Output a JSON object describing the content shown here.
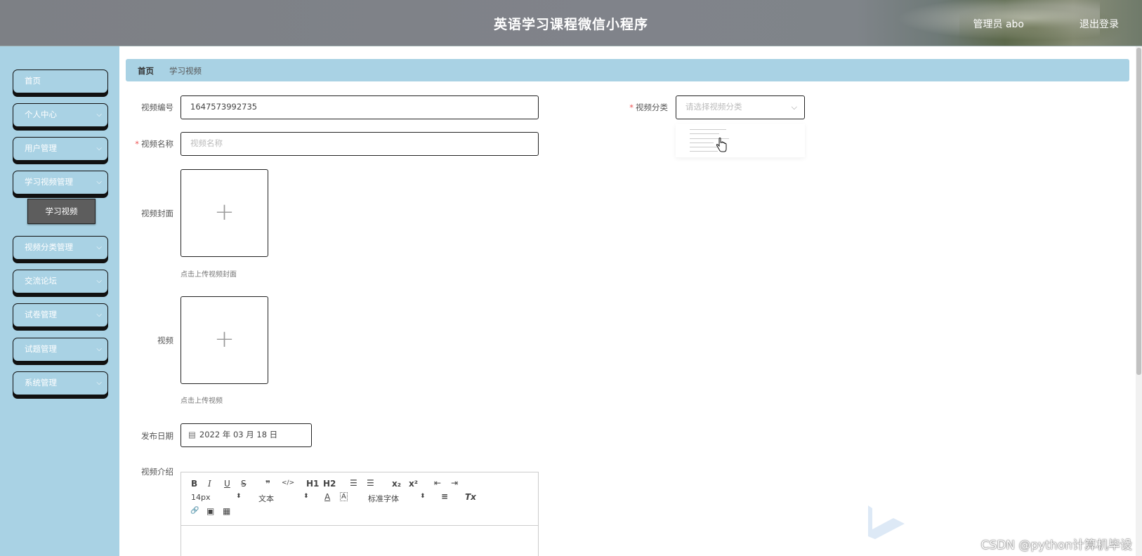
{
  "header": {
    "title": "英语学习课程微信小程序",
    "user": "管理员 abo",
    "logout": "退出登录"
  },
  "sidebar": {
    "items": [
      {
        "label": "首页",
        "has_children": false
      },
      {
        "label": "个人中心",
        "has_children": true
      },
      {
        "label": "用户管理",
        "has_children": true
      },
      {
        "label": "学习视频管理",
        "has_children": true
      },
      {
        "label": "视频分类管理",
        "has_children": true
      },
      {
        "label": "交流论坛",
        "has_children": true
      },
      {
        "label": "试卷管理",
        "has_children": true
      },
      {
        "label": "试题管理",
        "has_children": true
      },
      {
        "label": "系统管理",
        "has_children": true
      }
    ],
    "subitem": "学习视频"
  },
  "breadcrumb": {
    "home": "首页",
    "current": "学习视频"
  },
  "form": {
    "video_no": {
      "label": "视频编号",
      "value": "1647573992735"
    },
    "video_name": {
      "label": "视频名称",
      "placeholder": "视频名称",
      "required": true
    },
    "category": {
      "label": "视频分类",
      "placeholder": "请选择视频分类",
      "required": true
    },
    "cover": {
      "label": "视频封面",
      "hint": "点击上传视频封面"
    },
    "video": {
      "label": "视频",
      "hint": "点击上传视频"
    },
    "publish_date": {
      "label": "发布日期",
      "value": "2022 年 03 月 18 日"
    },
    "intro": {
      "label": "视频介绍"
    }
  },
  "editor": {
    "font_size": "14px",
    "paragraph": "文本",
    "font_family": "标准字体",
    "buttons": {
      "bold": "B",
      "italic": "I",
      "underline": "U",
      "strike": "S",
      "quote": "❞",
      "code": "</>",
      "h1": "H1",
      "h2": "H2",
      "ol": "☰",
      "ul": "☰",
      "sub": "x₂",
      "sup": "x²",
      "outdent": "⇤",
      "indent": "⇥",
      "color": "A",
      "bg": "A",
      "align": "≡",
      "clean": "Tx",
      "link": "🔗",
      "image": "▣",
      "video": "▦"
    }
  },
  "watermark": "CSDN @python计算机毕设",
  "colors": {
    "sidebar": "#a9d2e4",
    "subitem": "#5d5d5d",
    "header": "#7f8388"
  }
}
